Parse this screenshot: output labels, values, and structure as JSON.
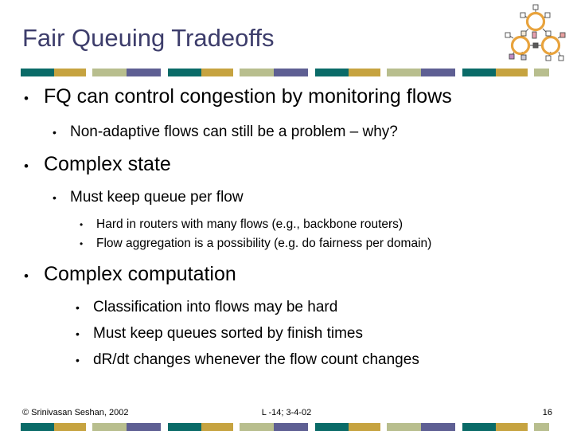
{
  "slide": {
    "title": "Fair Queuing Tradeoffs",
    "page_number": "16",
    "colors": {
      "title": "#3d3d6b",
      "teal": "#0a6b68",
      "gold": "#c6a340",
      "sage": "#b8be8e",
      "slate": "#5e5f93",
      "body_text": "#000000",
      "clipart_ring": "#e8a33d",
      "clipart_node": "#9aa0b4"
    },
    "bullet_marks": {
      "level1": "•",
      "level2": "•",
      "level3": "•",
      "level4": "•"
    },
    "color_bar_pattern": [
      "teal",
      "gold",
      "sage",
      "slate"
    ],
    "color_bar_repeats": 4,
    "content": [
      {
        "level": 1,
        "text": "FQ can control congestion by monitoring flows"
      },
      {
        "level": 2,
        "text": "Non-adaptive flows can still be a problem – why?"
      },
      {
        "level": 1,
        "text": "Complex state"
      },
      {
        "level": 2,
        "text": "Must keep queue per flow"
      },
      {
        "level": 4,
        "text": "Hard in routers with many flows (e.g., backbone routers)"
      },
      {
        "level": 4,
        "text": "Flow aggregation is a possibility (e.g. do fairness per domain)"
      },
      {
        "level": 1,
        "text": "Complex computation"
      },
      {
        "level": 3,
        "text": "Classification into flows may be hard"
      },
      {
        "level": 3,
        "text": "Must keep queues sorted by finish times"
      },
      {
        "level": 3,
        "text": "dR/dt changes whenever the flow count changes"
      }
    ],
    "footer": {
      "copyright": "© Srinivasan Seshan, 2002",
      "lecture": "L -14; 3-4-02",
      "page": "16"
    }
  }
}
